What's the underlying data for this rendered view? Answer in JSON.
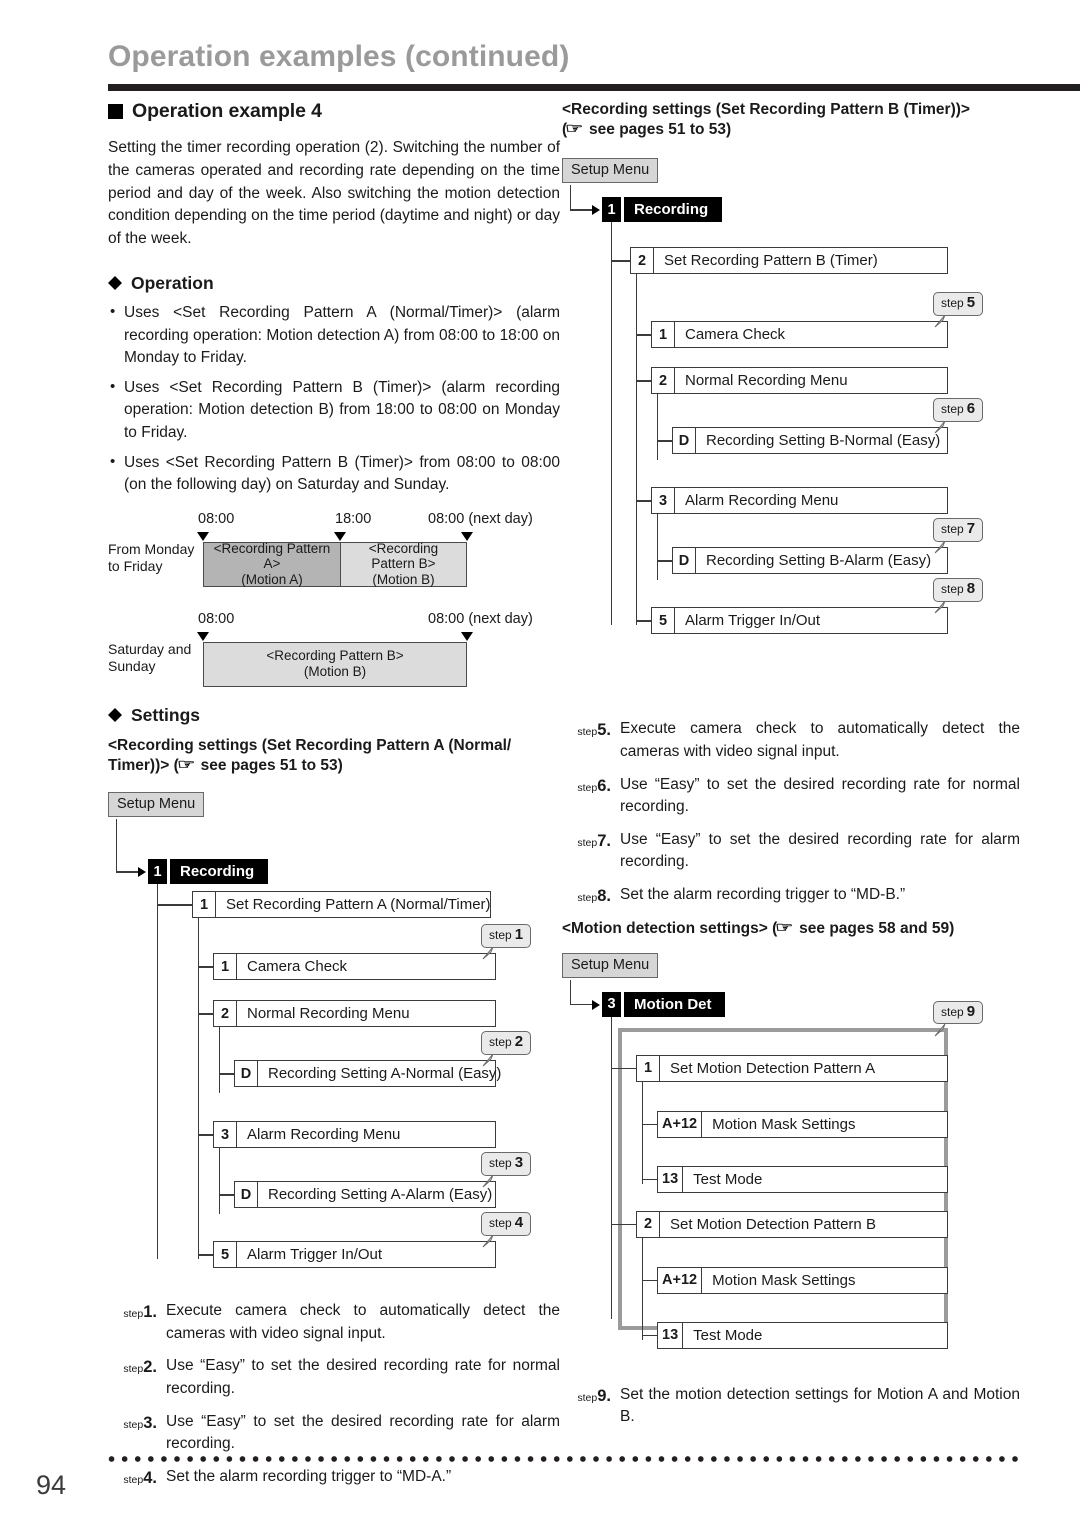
{
  "header": {
    "title": "Operation examples (continued)"
  },
  "left": {
    "section_heading": "Operation example 4",
    "intro": "Setting the timer recording operation (2). Switching the number of the cameras operated and recording rate depending on the time period and day of the week. Also switching the motion detection condition depending on the time period (daytime and night) or day of the week.",
    "operation_heading": "Operation",
    "operation_bullets": [
      "Uses <Set Recording Pattern A (Normal/Timer)> (alarm recording operation: Motion detection A) from 08:00 to 18:00 on Monday to Friday.",
      "Uses <Set Recording Pattern B (Timer)> (alarm recording operation: Motion detection B) from 18:00 to 08:00 on Monday to Friday.",
      "Uses <Set Recording Pattern B (Timer)> from 08:00 to 08:00 (on the following day) on Saturday and Sunday."
    ],
    "timeline": {
      "row1": {
        "label_line1": "From Monday",
        "label_line2": "to Friday",
        "times": [
          "08:00",
          "18:00",
          "08:00 (next day)"
        ],
        "segments": [
          {
            "line1": "<Recording Pattern A>",
            "line2": "(Motion A)",
            "shade": "dark"
          },
          {
            "line1": "<Recording",
            "line2": "Pattern B>",
            "line3": "(Motion B)",
            "shade": "light"
          }
        ]
      },
      "row2": {
        "label_line1": "Saturday and",
        "label_line2": "Sunday",
        "times": [
          "08:00",
          "08:00 (next day)"
        ],
        "segments": [
          {
            "line1": "<Recording Pattern B>",
            "line2": "(Motion B)",
            "shade": "light"
          }
        ]
      }
    },
    "settings_heading": "Settings",
    "settings_subhead_l1": "<Recording settings (Set Recording Pattern A (Normal/",
    "settings_subhead_l2_pre": "Timer))> (",
    "settings_subhead_l2_post": " see pages 51 to 53)",
    "flow": {
      "setup_menu": "Setup Menu",
      "menu_num": "1",
      "menu_label": "Recording",
      "rows": [
        {
          "num": "1",
          "label": "Set Recording Pattern A (Normal/Timer)",
          "step": null
        },
        {
          "num": "1",
          "label": "Camera Check",
          "step": "1"
        },
        {
          "num": "2",
          "label": "Normal Recording Menu",
          "step": null
        },
        {
          "num": "D",
          "label": "Recording Setting A-Normal (Easy)",
          "step": "2"
        },
        {
          "num": "3",
          "label": "Alarm Recording Menu",
          "step": null
        },
        {
          "num": "D",
          "label": "Recording Setting A-Alarm (Easy)",
          "step": "3"
        },
        {
          "num": "5",
          "label": "Alarm Trigger In/Out",
          "step": "4"
        }
      ]
    },
    "steps": [
      {
        "key": "1",
        "text": "Execute camera check to automatically detect the cameras with video signal input."
      },
      {
        "key": "2",
        "text": "Use “Easy” to set the desired recording rate for normal recording."
      },
      {
        "key": "3",
        "text": "Use “Easy” to set the desired recording rate for alarm recording."
      },
      {
        "key": "4",
        "text": "Set the alarm recording trigger to “MD-A.”"
      }
    ]
  },
  "right": {
    "rec_subhead_l1": "<Recording settings (Set Recording Pattern B (Timer))>",
    "rec_subhead_l2_pre": "(",
    "rec_subhead_l2_post": " see pages 51 to 53)",
    "flow": {
      "setup_menu": "Setup Menu",
      "menu_num": "1",
      "menu_label": "Recording",
      "rows": [
        {
          "num": "2",
          "label": "Set Recording Pattern B (Timer)",
          "step": null
        },
        {
          "num": "1",
          "label": "Camera Check",
          "step": "5"
        },
        {
          "num": "2",
          "label": "Normal Recording Menu",
          "step": null
        },
        {
          "num": "D",
          "label": "Recording Setting B-Normal (Easy)",
          "step": "6"
        },
        {
          "num": "3",
          "label": "Alarm Recording Menu",
          "step": null
        },
        {
          "num": "D",
          "label": "Recording Setting B-Alarm (Easy)",
          "step": "7"
        },
        {
          "num": "5",
          "label": "Alarm Trigger In/Out",
          "step": "8"
        }
      ]
    },
    "steps": [
      {
        "key": "5",
        "text": "Execute camera check to automatically detect the cameras with video signal input."
      },
      {
        "key": "6",
        "text": "Use “Easy” to set the desired recording rate for normal recording."
      },
      {
        "key": "7",
        "text": "Use “Easy” to set the desired recording rate for alarm recording."
      },
      {
        "key": "8",
        "text": "Set the alarm recording trigger to “MD-B.”"
      }
    ],
    "md_subhead_pre": "<Motion detection settings> (",
    "md_subhead_post": " see pages 58 and 59)",
    "md_flow": {
      "setup_menu": "Setup Menu",
      "menu_num": "3",
      "menu_label": "Motion Det",
      "step_badge": "9",
      "rows": [
        {
          "num": "1",
          "label": "Set Motion Detection Pattern A"
        },
        {
          "num": "A+12",
          "label": "Motion Mask Settings"
        },
        {
          "num": "13",
          "label": "Test Mode"
        },
        {
          "num": "2",
          "label": "Set Motion Detection Pattern B"
        },
        {
          "num": "A+12",
          "label": "Motion Mask Settings"
        },
        {
          "num": "13",
          "label": "Test Mode"
        }
      ]
    },
    "md_steps": [
      {
        "key": "9",
        "text": "Set the motion detection settings for Motion A and Motion B."
      }
    ]
  },
  "footer": {
    "page_number": "94"
  },
  "icons": {
    "hand_pointer": "☞"
  },
  "colors": {
    "title_gray": "#9a9a9a",
    "rule_black": "#231f20",
    "menu_black": "#000000",
    "setup_gray": "#d6d6d6",
    "segment_dark": "#b4b4b4",
    "segment_light": "#dcdcdc",
    "frame_gray": "#9b9b9b"
  }
}
